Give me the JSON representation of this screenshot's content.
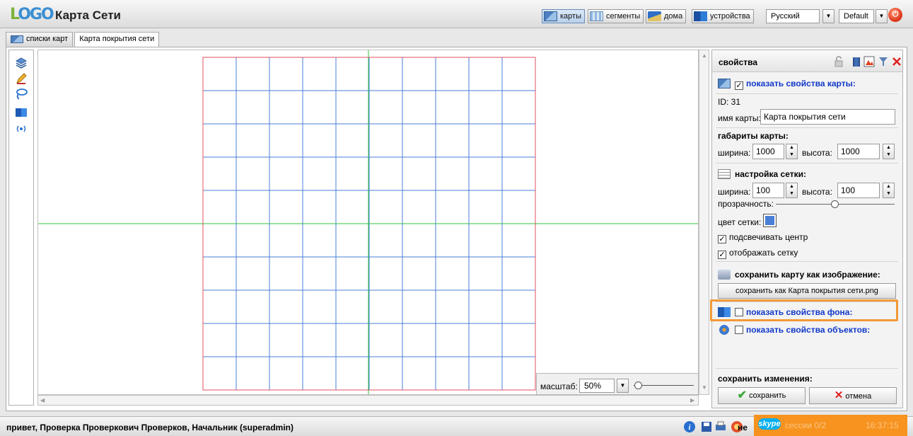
{
  "app": {
    "title": "Карта Сети",
    "logo_text_first": "L",
    "logo_text_rest": "OGO"
  },
  "nav": {
    "maps": "карты",
    "segments": "сегменты",
    "houses": "дома",
    "devices": "устройства",
    "language": "Русский",
    "theme": "Default"
  },
  "tabs": [
    {
      "label": "списки карт"
    },
    {
      "label": "Карта покрытия сети"
    }
  ],
  "toolbar": [
    "layers-icon",
    "pencil-icon",
    "lasso-icon",
    "image-icon",
    "signal-icon"
  ],
  "canvas": {
    "grid_line_color": "#4a7fd8",
    "border_color": "#e05060",
    "center_line_color": "#30c040"
  },
  "zoom": {
    "label": "масштаб:",
    "value": "50%"
  },
  "props": {
    "title": "свойства",
    "show_map_props": "показать свойства карты:",
    "id_label": "ID: 31",
    "map_name_label": "имя карты:",
    "map_name_value": "Карта покрытия сети",
    "dims_title": "габариты карты:",
    "width_label": "ширина:",
    "width_value": "1000",
    "height_label": "высота:",
    "height_value": "1000",
    "grid_title": "настройка сетки:",
    "grid_width_label": "ширина:",
    "grid_width_value": "100",
    "grid_height_label": "высота:",
    "grid_height_value": "100",
    "opacity_label": "прозрачность:",
    "grid_color_label": "цвет сетки:",
    "grid_color": "#4a7fd8",
    "highlight_center": "подсвечивать центр",
    "show_grid": "отображать сетку",
    "save_image_title": "сохранить карту как изображение:",
    "save_image_button": "сохранить как Карта покрытия сети.png",
    "show_bg_props": "показать свойства фона:",
    "show_obj_props": "показать свойства объектов:",
    "save_changes_title": "сохранить изменения:",
    "save_button": "сохранить",
    "cancel_button": "отмена"
  },
  "status": {
    "greeting": "привет, Проверка Проверкович Проверков, Начальник (superadmin)",
    "ne": "не",
    "skype_logo": "skype",
    "skype_text": "сессии 0/2",
    "clock": "16:37:15"
  }
}
